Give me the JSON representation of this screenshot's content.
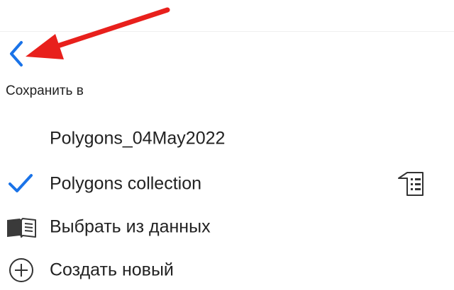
{
  "header": {
    "back_icon": "chevron-left-icon",
    "accent_color": "#1a73e8",
    "annotation_color": "#e8201c"
  },
  "save_to": {
    "label": "Сохранить в",
    "items": [
      {
        "label": "Polygons_04May2022",
        "icon": "",
        "selected": false
      },
      {
        "label": "Polygons collection",
        "icon": "checkmark-icon",
        "selected": true,
        "trailing_icon": "layer-list-icon"
      },
      {
        "label": "Выбрать из данных",
        "icon": "open-book-icon",
        "selected": false
      },
      {
        "label": "Создать новый",
        "icon": "plus-circle-icon",
        "selected": false
      }
    ]
  }
}
